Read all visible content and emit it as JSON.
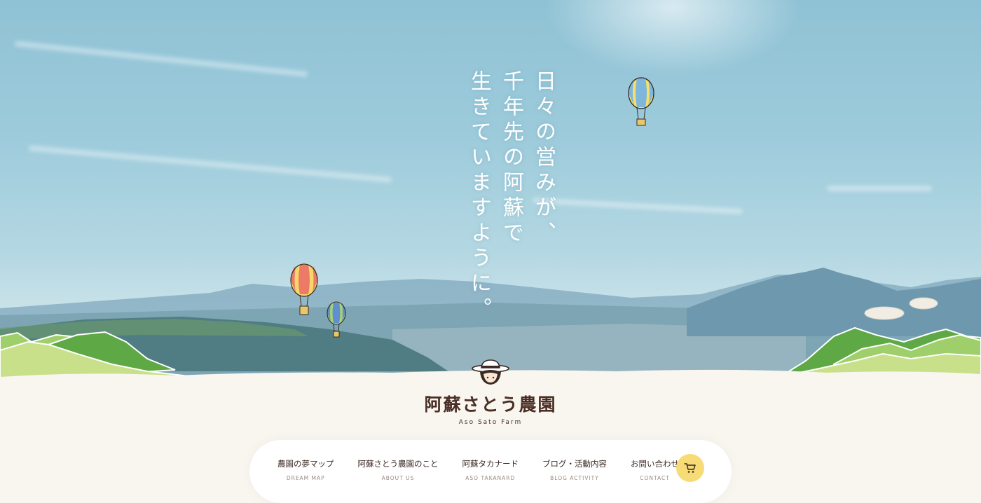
{
  "catchcopy": {
    "line1": "日々の営みが、",
    "line2": "千年先の阿蘇で",
    "line3": "生きていますように。"
  },
  "logo": {
    "name": "阿蘇さとう農園",
    "sub": "Aso Sato Farm"
  },
  "nav": {
    "items": [
      {
        "jp": "農園の夢マップ",
        "en": "DREAM MAP"
      },
      {
        "jp": "阿蘇さとう農園のこと",
        "en": "ABOUT US"
      },
      {
        "jp": "阿蘇タカナード",
        "en": "ASO TAKANARD"
      },
      {
        "jp": "ブログ・活動内容",
        "en": "BLOG ACTIVITY"
      },
      {
        "jp": "お問い合わせ",
        "en": "CONTACT"
      }
    ],
    "cart_icon": "cart-icon"
  },
  "colors": {
    "sky": "#9dcbdb",
    "ground": "#f8f6ef",
    "brand_brown": "#4a2e25",
    "cart_yellow": "#f7db76",
    "hill_green": "#8cc95a"
  }
}
